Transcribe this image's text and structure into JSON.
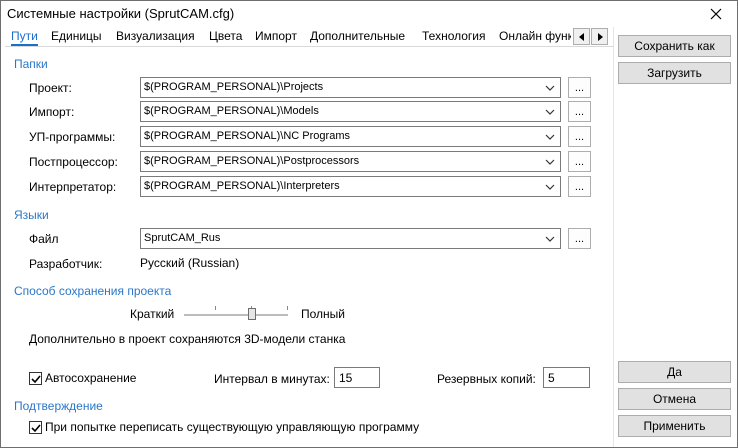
{
  "window": {
    "title": "Системные настройки (SprutCAM.cfg)"
  },
  "tabs": [
    {
      "label": "Пути",
      "active": true
    },
    {
      "label": "Единицы"
    },
    {
      "label": "Визуализация"
    },
    {
      "label": "Цвета"
    },
    {
      "label": "Импорт"
    },
    {
      "label": "Дополнительные"
    },
    {
      "label": "Технология"
    },
    {
      "label": "Онлайн функ"
    }
  ],
  "folders": {
    "header": "Папки",
    "rows": [
      {
        "label": "Проект:",
        "value": "$(PROGRAM_PERSONAL)\\Projects"
      },
      {
        "label": "Импорт:",
        "value": "$(PROGRAM_PERSONAL)\\Models"
      },
      {
        "label": "УП-программы:",
        "value": "$(PROGRAM_PERSONAL)\\NC Programs"
      },
      {
        "label": "Постпроцессор:",
        "value": "$(PROGRAM_PERSONAL)\\Postprocessors"
      },
      {
        "label": "Интерпретатор:",
        "value": "$(PROGRAM_PERSONAL)\\Interpreters"
      }
    ],
    "browse_label": "..."
  },
  "languages": {
    "header": "Языки",
    "file_label": "Файл",
    "file_value": "SprutCAM_Rus",
    "developer_label": "Разработчик:",
    "developer_value": "Русский (Russian)"
  },
  "save_mode": {
    "header": "Способ сохранения проекта",
    "min_label": "Краткий",
    "max_label": "Полный",
    "level": 0.68,
    "note": "Дополнительно в проект сохраняются 3D-модели станка"
  },
  "autosave": {
    "checkbox_label": "Автосохранение",
    "checked": true,
    "interval_label": "Интервал в минутах:",
    "interval_value": "15",
    "backups_label": "Резервных копий:",
    "backups_value": "5"
  },
  "confirmation": {
    "header": "Подтверждение",
    "overwrite_label": "При попытке переписать существующую управляющую программу",
    "checked": true
  },
  "buttons": {
    "save_as": "Сохранить как",
    "load": "Загрузить",
    "ok": "Да",
    "cancel": "Отмена",
    "apply": "Применить"
  },
  "colors": {
    "accent": "#2a77c9"
  }
}
